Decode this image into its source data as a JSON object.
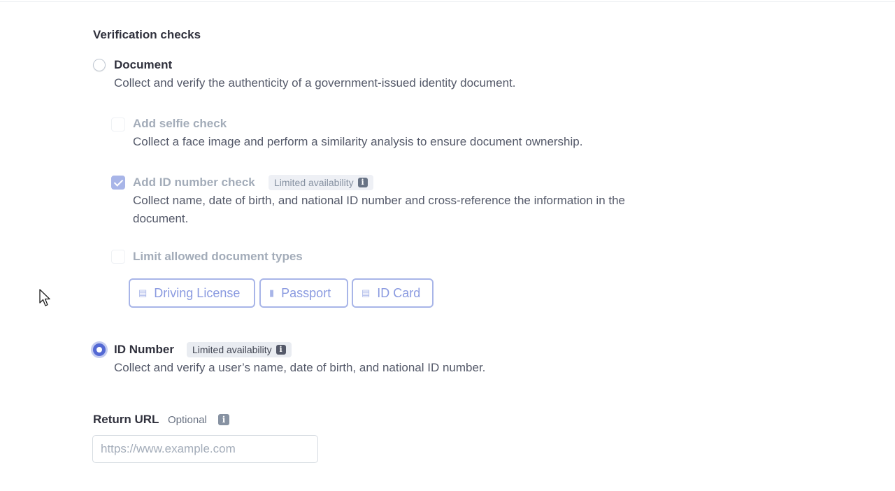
{
  "section_title": "Verification checks",
  "options": {
    "document": {
      "label": "Document",
      "description": "Collect and verify the authenticity of a government-issued identity document.",
      "selected": false
    },
    "selfie": {
      "label": "Add selfie check",
      "description": "Collect a face image and perform a similarity analysis to ensure document ownership.",
      "checked": false
    },
    "id_number_check": {
      "label": "Add ID number check",
      "badge": "Limited availability",
      "description_line1": "Collect name, date of birth, and national ID number and cross-reference the information in the",
      "description_line2": "document.",
      "checked": true
    },
    "limit_types": {
      "label": "Limit allowed document types",
      "checked": false,
      "types": [
        {
          "label": "Driving License",
          "icon": "id-card-icon"
        },
        {
          "label": "Passport",
          "icon": "passport-icon"
        },
        {
          "label": "ID Card",
          "icon": "id-card-icon"
        }
      ]
    },
    "id_number": {
      "label": "ID Number",
      "badge": "Limited availability",
      "description": "Collect and verify a user’s name, date of birth, and national ID number.",
      "selected": true
    }
  },
  "return_url": {
    "label": "Return URL",
    "optional": "Optional",
    "placeholder": "https://www.example.com",
    "value": ""
  },
  "colors": {
    "accent": "#5469d4",
    "accent_disabled": "#a8b5e8",
    "text": "#30313d",
    "muted_text": "#a3acb9"
  }
}
